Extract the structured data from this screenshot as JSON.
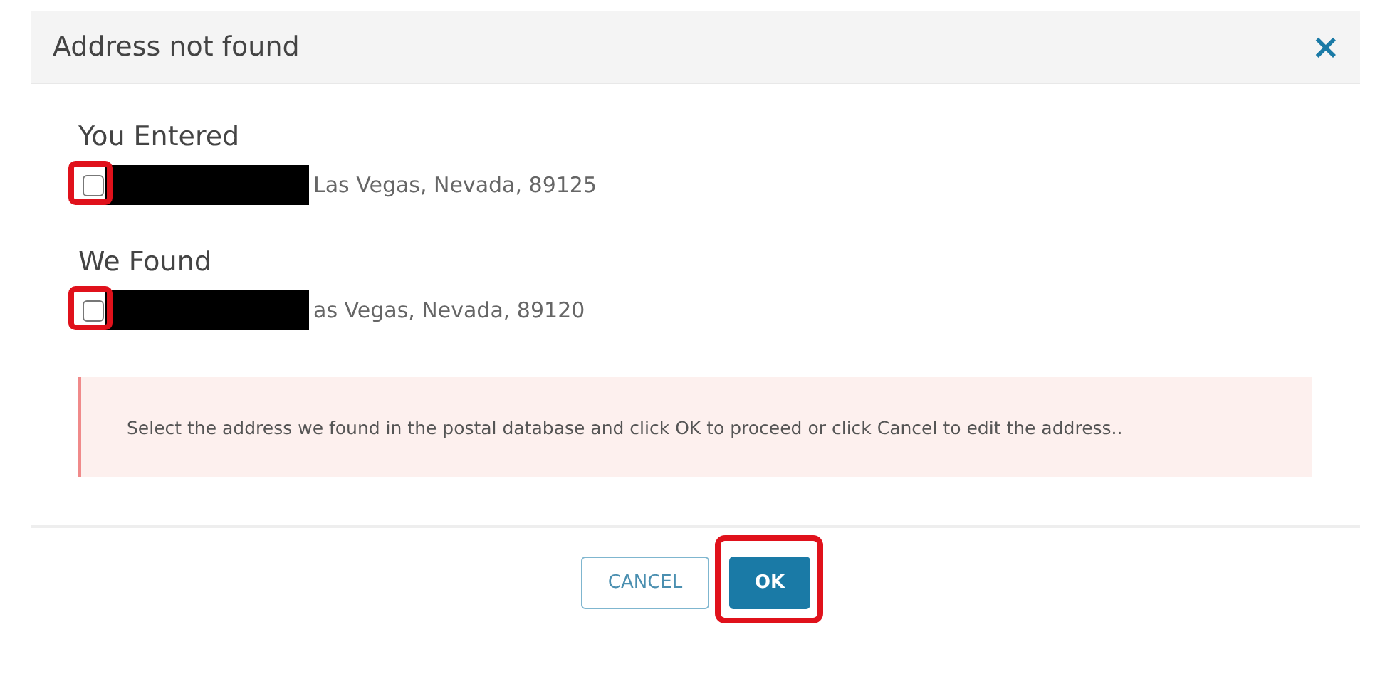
{
  "dialog": {
    "title": "Address not found",
    "close_icon": "×"
  },
  "sections": [
    {
      "heading": "You Entered",
      "option": {
        "checked": false,
        "annotated": true,
        "redacted": true,
        "address": "Las Vegas, Nevada, 89125"
      }
    },
    {
      "heading": "We Found",
      "option": {
        "checked": false,
        "annotated": true,
        "redacted": true,
        "address": "as Vegas, Nevada, 89120"
      }
    }
  ],
  "alert": {
    "message": "Select the address we found in the postal database and click OK to proceed or click Cancel to edit the address.."
  },
  "buttons": [
    {
      "label": "CANCEL",
      "kind": "secondary",
      "annotated": false
    },
    {
      "label": "OK",
      "kind": "primary",
      "annotated": true
    }
  ]
}
